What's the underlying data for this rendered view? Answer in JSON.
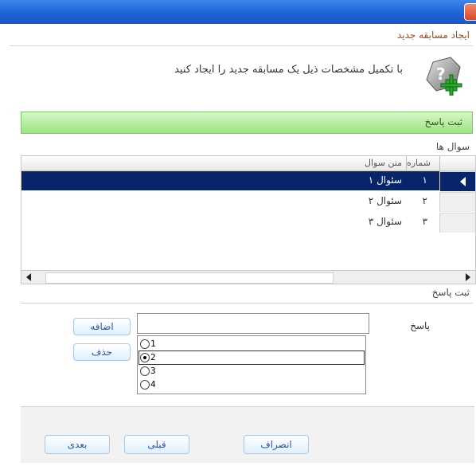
{
  "dialog": {
    "heading": "ایجاد مسابقه جدید",
    "instruction": "با تکمیل مشخصات ذیل یک مسابقه جدید را ایجاد کنید"
  },
  "section": {
    "title": "ثبت پاسخ"
  },
  "questions_grid": {
    "caption": "سوال ها",
    "columns": {
      "number": "شماره",
      "text": "متن سوال"
    },
    "rows": [
      {
        "number": "۱",
        "text": "سئوال ۱",
        "selected": true
      },
      {
        "number": "۲",
        "text": "سئوال ۲",
        "selected": false
      },
      {
        "number": "۳",
        "text": "سئوال ۳",
        "selected": false
      }
    ]
  },
  "answer_section": {
    "caption": "ثبت پاسخ",
    "label": "پاسخ",
    "input_value": "",
    "add_button": "اضافه",
    "delete_button": "حذف",
    "options": [
      {
        "label": "1",
        "checked": false
      },
      {
        "label": "2",
        "checked": true
      },
      {
        "label": "3",
        "checked": false
      },
      {
        "label": "4",
        "checked": false
      }
    ]
  },
  "footer": {
    "next_button": "بعدی",
    "prev_button": "قبلی",
    "cancel_button": "انصراف"
  },
  "colors": {
    "titlebar": "#2a6fdf",
    "selection": "#08246b",
    "section_bar": "#9ae47f",
    "heading": "#9c4c1c",
    "button_text": "#2c56b5"
  }
}
